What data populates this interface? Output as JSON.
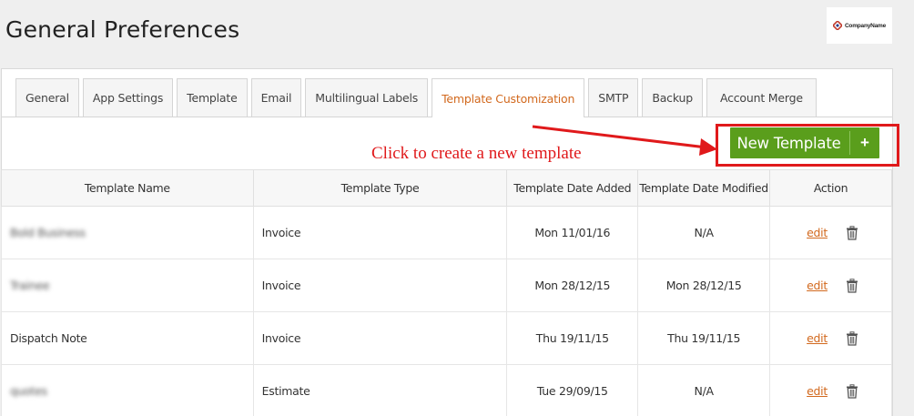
{
  "page": {
    "title": "General Preferences"
  },
  "logo": {
    "text": "CompanyName",
    "icon": "company-logo-icon"
  },
  "tabs": [
    {
      "label": "General",
      "active": false
    },
    {
      "label": "App Settings",
      "active": false
    },
    {
      "label": "Template",
      "active": false
    },
    {
      "label": "Email",
      "active": false
    },
    {
      "label": "Multilingual Labels",
      "active": false
    },
    {
      "label": "Template Customization",
      "active": true
    },
    {
      "label": "SMTP",
      "active": false
    },
    {
      "label": "Backup",
      "active": false
    },
    {
      "label": "Account Merge",
      "active": false
    }
  ],
  "annotation": {
    "text": "Click to create a new template",
    "color": "#e0191b"
  },
  "toolbar": {
    "new_template_label": "New Template",
    "new_template_icon": "+",
    "button_color": "#5a9e1c"
  },
  "table": {
    "headers": {
      "name": "Template Name",
      "type": "Template Type",
      "added": "Template Date Added",
      "modified": "Template Date Modified",
      "action": "Action"
    },
    "edit_label": "edit",
    "rows": [
      {
        "name": "Bold Business",
        "name_blurred": true,
        "type": "Invoice",
        "added": "Mon 11/01/16",
        "modified": "N/A"
      },
      {
        "name": "Trainee",
        "name_blurred": true,
        "type": "Invoice",
        "added": "Mon 28/12/15",
        "modified": "Mon 28/12/15"
      },
      {
        "name": "Dispatch Note",
        "name_blurred": false,
        "type": "Invoice",
        "added": "Thu 19/11/15",
        "modified": "Thu 19/11/15"
      },
      {
        "name": "quotes",
        "name_blurred": true,
        "type": "Estimate",
        "added": "Tue 29/09/15",
        "modified": "N/A"
      }
    ]
  },
  "colors": {
    "accent_orange": "#d2691e",
    "annotation_red": "#e0191b"
  }
}
